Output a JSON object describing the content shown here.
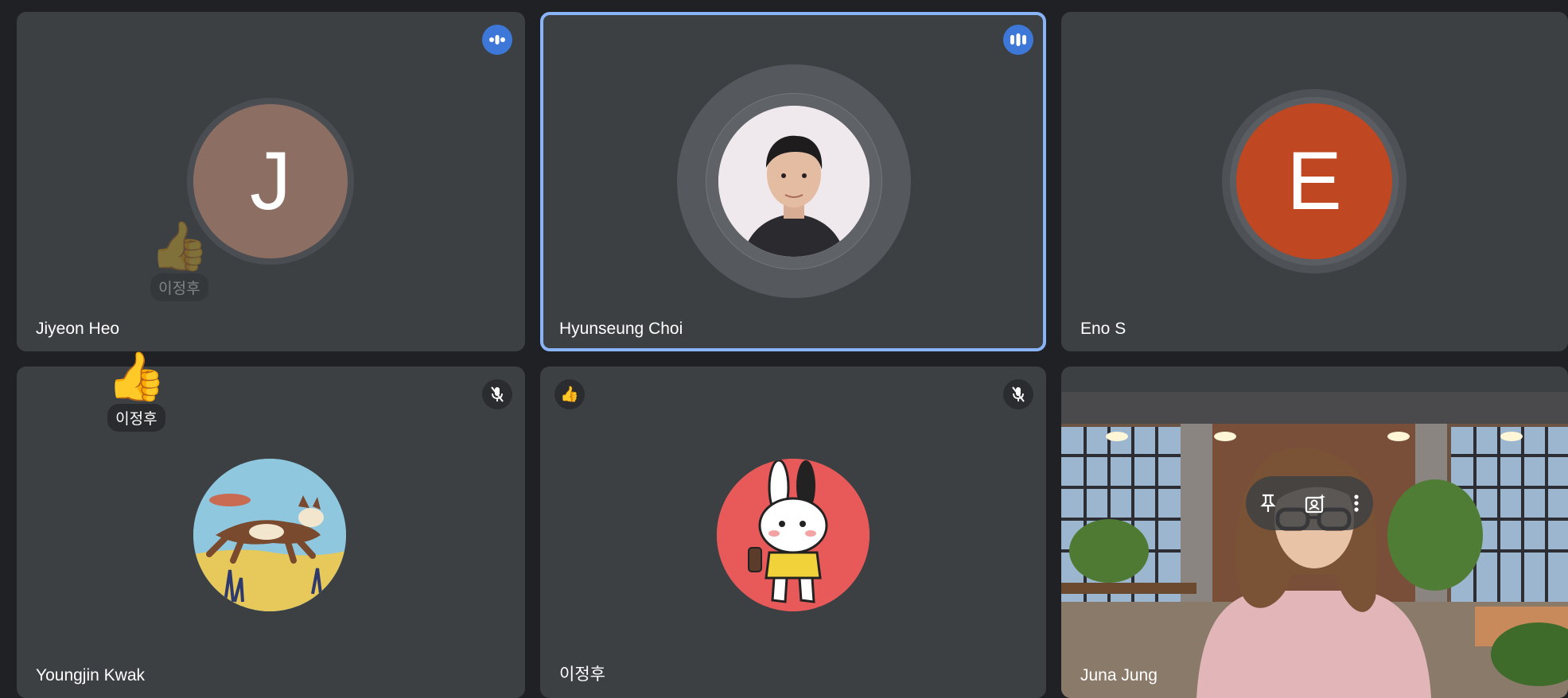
{
  "participants": [
    {
      "name": "Jiyeon Heo",
      "initial": "J",
      "avatar_color": "#8d6e63",
      "status": "speaking-indicator"
    },
    {
      "name": "Hyunseung Choi",
      "status": "speaking-indicator",
      "active_speaker": true
    },
    {
      "name": "Eno S",
      "initial": "E",
      "avatar_color": "#bf4722"
    },
    {
      "name": "Youngjin Kwak",
      "status": "muted"
    },
    {
      "name": "이정후",
      "status": "muted",
      "reaction_badge": "👍"
    },
    {
      "name": "Juna Jung",
      "video": true
    }
  ],
  "reactions": [
    {
      "emoji": "👍",
      "sender": "이정후",
      "faded": true
    },
    {
      "emoji": "👍",
      "sender": "이정후",
      "faded": false
    }
  ],
  "tile_controls": {
    "pin": "pin-icon",
    "camera": "add-camera-effect-icon",
    "more": "more-options-icon"
  },
  "colors": {
    "tile_bg": "#3c4043",
    "page_bg": "#202124",
    "active_border": "#8ab4f8",
    "speaking_badge": "#3d78d8"
  }
}
